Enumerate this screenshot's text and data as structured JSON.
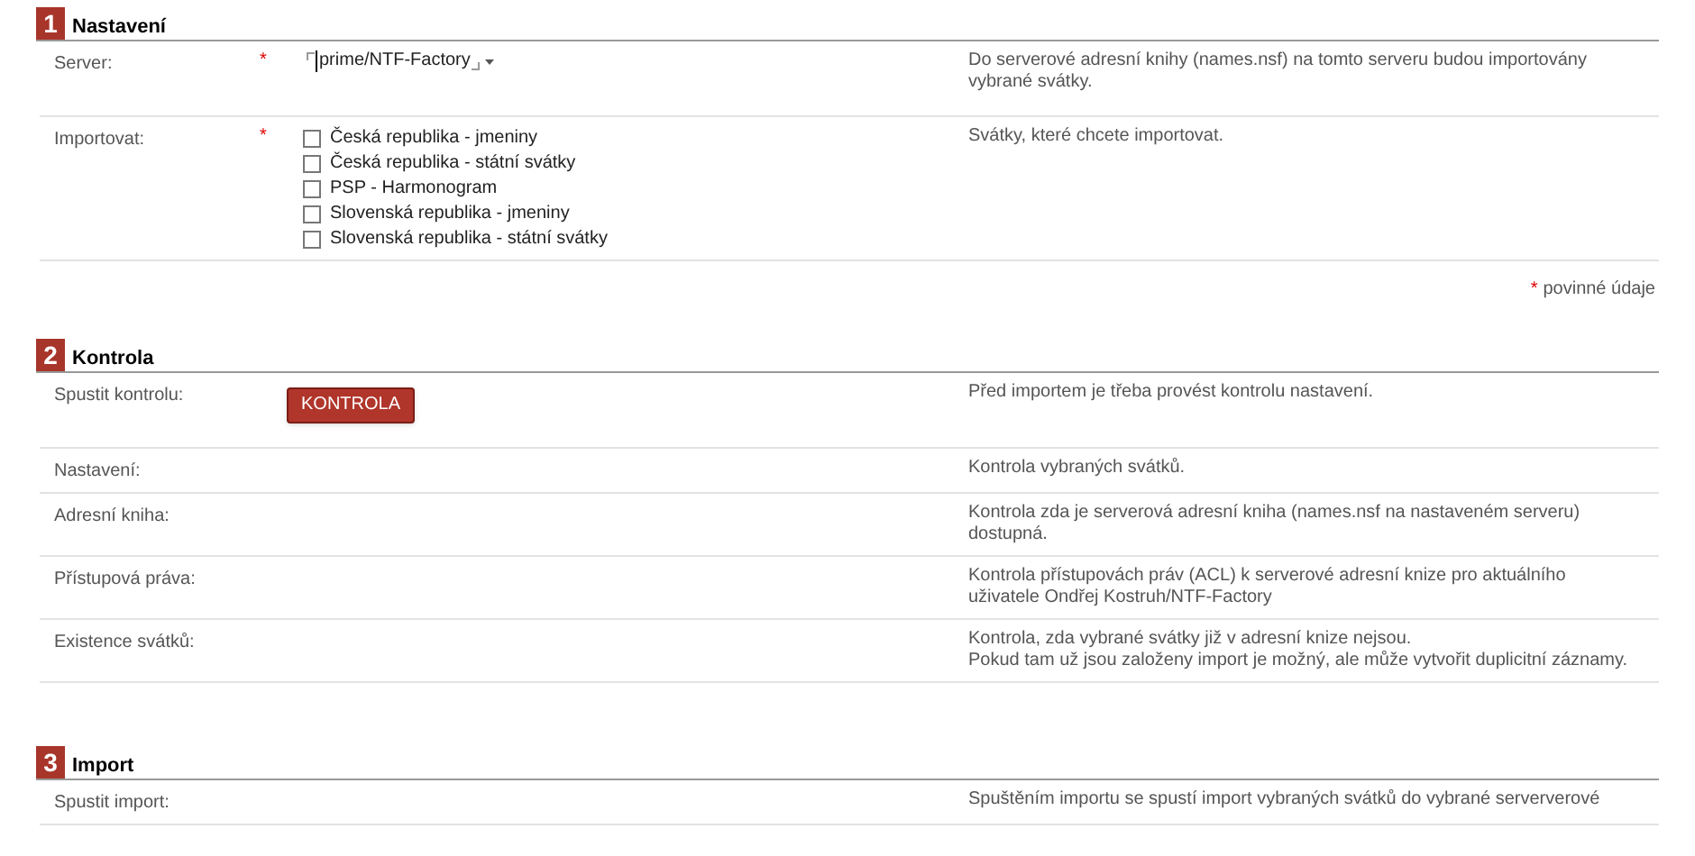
{
  "required_mark": "*",
  "sections": [
    {
      "number": "1",
      "title": "Nastavení",
      "rows": [
        {
          "kind": "select",
          "label": "Server:",
          "required": true,
          "value": "prime/NTF-Factory",
          "description": "Do serverové adresní knihy (names.nsf) na tomto serveru budou importovány vybrané svátky."
        },
        {
          "kind": "checkboxes",
          "label": "Importovat:",
          "required": true,
          "options": [
            {
              "label": "Česká republika - jmeniny",
              "checked": false
            },
            {
              "label": "Česká republika - státní svátky",
              "checked": false
            },
            {
              "label": "PSP - Harmonogram",
              "checked": false
            },
            {
              "label": "Slovenská republika - jmeniny",
              "checked": false
            },
            {
              "label": "Slovenská republika - státní svátky",
              "checked": false
            }
          ],
          "description": "Svátky, které chcete importovat."
        }
      ],
      "required_note": "povinné údaje"
    },
    {
      "number": "2",
      "title": "Kontrola",
      "rows": [
        {
          "kind": "button",
          "label": "Spustit kontrolu:",
          "button": "KONTROLA",
          "description": "Před importem je třeba provést kontrolu nastavení."
        },
        {
          "kind": "text",
          "label": "Nastavení:",
          "description": "Kontrola vybraných svátků."
        },
        {
          "kind": "text",
          "label": "Adresní kniha:",
          "description": "Kontrola zda je serverová adresní kniha (names.nsf na nastaveném serveru) dostupná."
        },
        {
          "kind": "text",
          "label": "Přístupová práva:",
          "description": "Kontrola přístupovách práv (ACL) k serverové adresní knize pro aktuálního uživatele Ondřej Kostruh/NTF-Factory"
        },
        {
          "kind": "text",
          "label": "Existence svátků:",
          "description": "Kontrola, zda vybrané svátky již v adresní knize nejsou.\nPokud tam už jsou založeny import je možný, ale může vytvořit duplicitní záznamy."
        }
      ]
    },
    {
      "number": "3",
      "title": "Import",
      "rows": [
        {
          "kind": "text",
          "label": "Spustit import:",
          "description": "Spuštěním importu se spustí import vybraných svátků do vybrané serververové"
        }
      ]
    }
  ]
}
